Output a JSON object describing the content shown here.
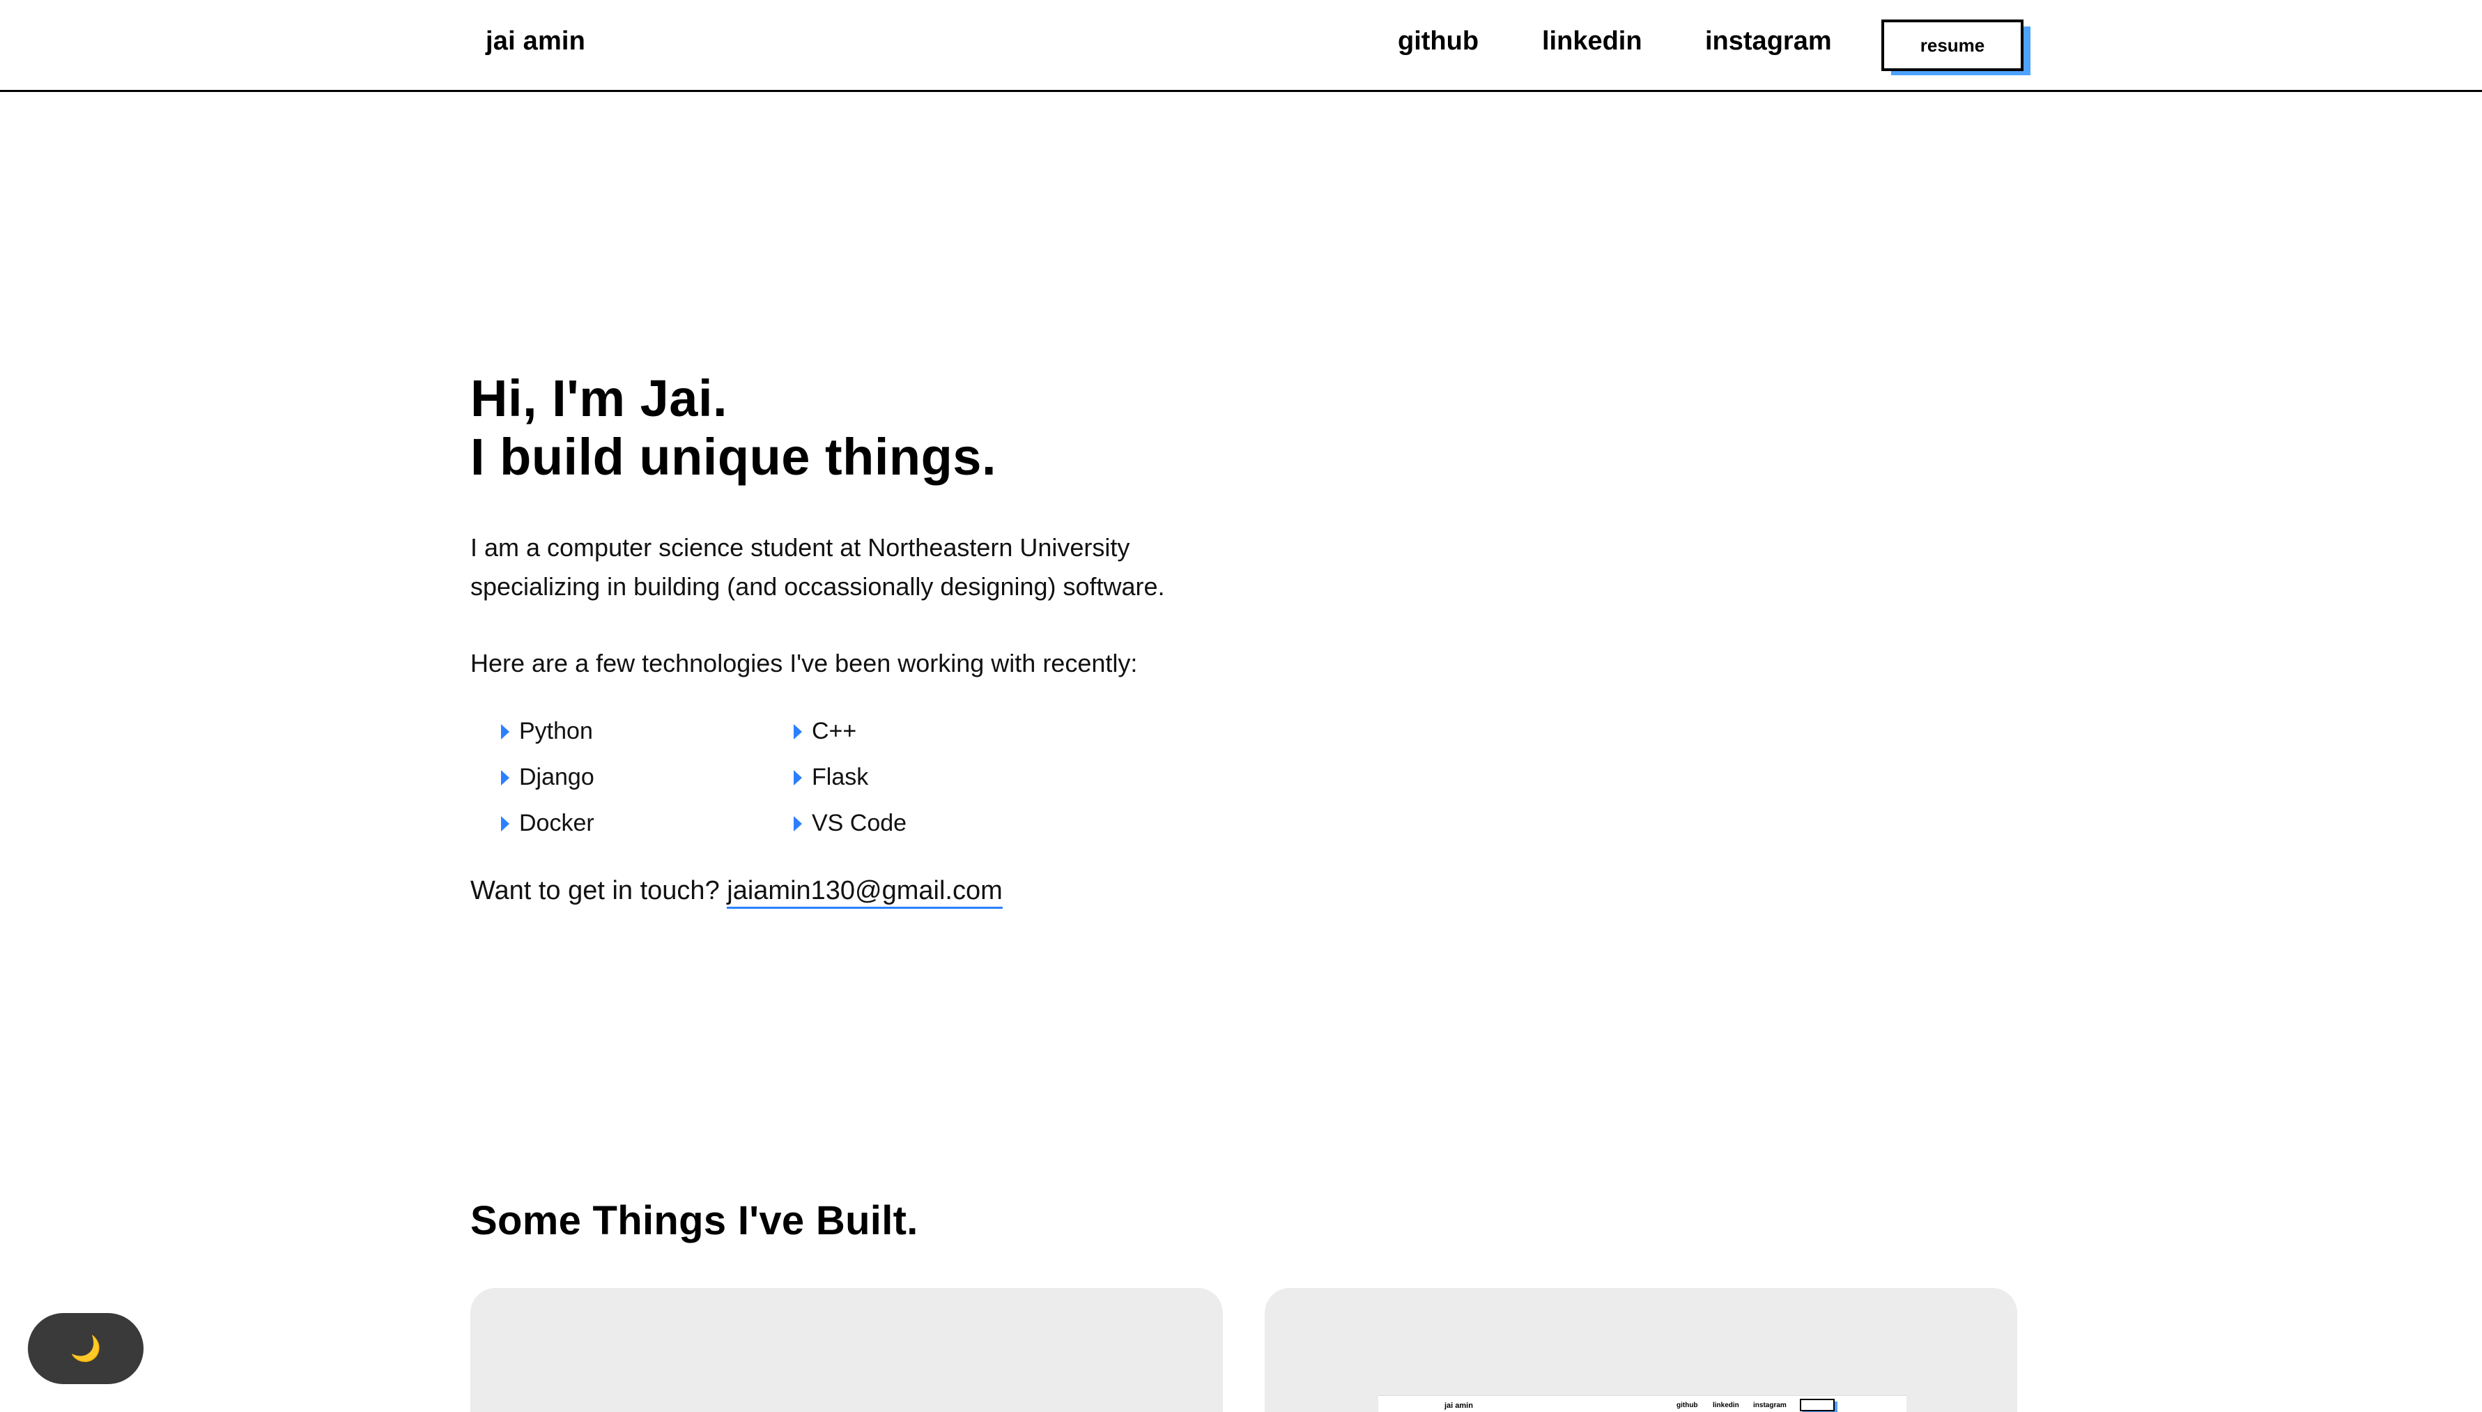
{
  "header": {
    "brand": "jai amin",
    "nav": {
      "github": "github",
      "linkedin": "linkedin",
      "instagram": "instagram"
    },
    "resume_label": "resume"
  },
  "hero": {
    "greeting": "Hi, I'm Jai.",
    "tagline": "I build unique things.",
    "intro_line1": "I am a computer science student at Northeastern University",
    "intro_line2": "specializing in building (and occassionally designing) software.",
    "tech_intro": "Here are a few technologies I've been working with recently:",
    "technologies": [
      "Python",
      "C++",
      "Django",
      "Flask",
      "Docker",
      "VS Code"
    ],
    "contact_prefix": "Want to get in touch?",
    "email": "jaiamin130@gmail.com"
  },
  "projects": {
    "title": "Some Things I've Built.",
    "preview": {
      "brand": "jai amin",
      "nav": [
        "github",
        "linkedin",
        "instagram"
      ]
    }
  },
  "theme_toggle": {
    "icon": "crescent-moon-icon",
    "glyph": "🌙"
  },
  "colors": {
    "accent": "#4da3ff",
    "link_underline": "#2b80ff",
    "card_bg": "#ececec",
    "toggle_bg": "#3a3a3a"
  }
}
